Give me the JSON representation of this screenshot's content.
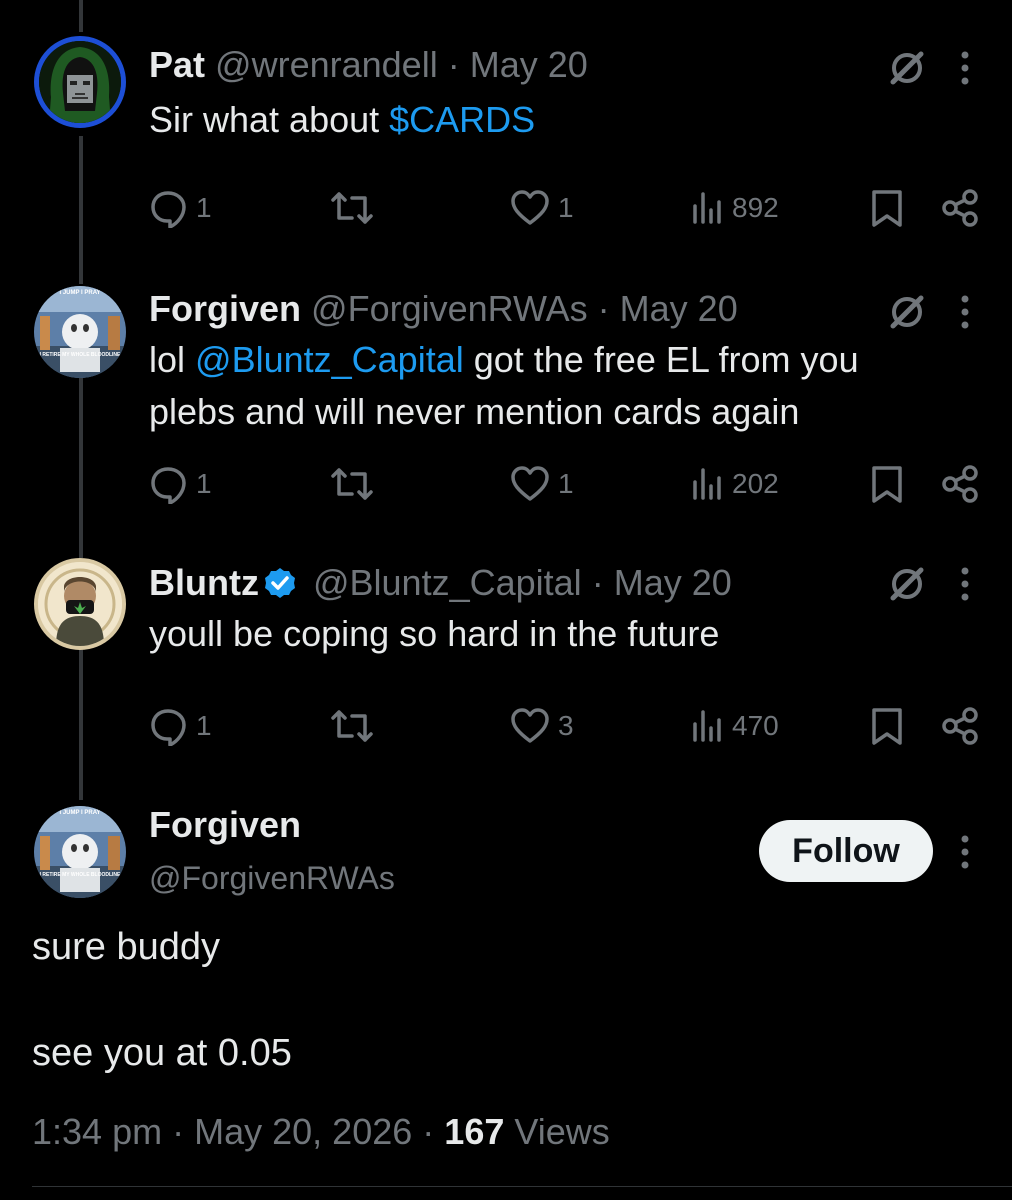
{
  "tweets": [
    {
      "name": "Pat",
      "handle": "@wrenrandell",
      "dot": "·",
      "date": "May 20",
      "text_plain": "Sir what about ",
      "text_link": "$CARDS",
      "replies": "1",
      "likes": "1",
      "views": "892"
    },
    {
      "name": "Forgiven",
      "handle": "@ForgivenRWAs",
      "dot": "·",
      "date": "May 20",
      "text_a": "lol ",
      "text_link": "@Bluntz_Capital",
      "text_b": " got the free EL from you plebs and will never mention cards again",
      "replies": "1",
      "likes": "1",
      "views": "202"
    },
    {
      "name": "Bluntz",
      "handle": "@Bluntz_Capital",
      "dot": "·",
      "date": "May 20",
      "text": "youll be coping so hard in the future",
      "replies": "1",
      "likes": "3",
      "views": "470"
    }
  ],
  "main": {
    "name": "Forgiven",
    "handle": "@ForgivenRWAs",
    "follow_label": "Follow",
    "line1": "sure buddy",
    "line2": "see you at 0.05",
    "time": "1:34 pm",
    "dot": "·",
    "date": "May 20, 2026",
    "dot2": "·",
    "views_count": "167",
    "views_label": " Views"
  },
  "avatar_text": {
    "top": "I JUMP I PRAY",
    "bottom": "I RETIRE MY WHOLE BLOODLINE"
  },
  "icons": [
    "reply-icon",
    "retweet-icon",
    "like-icon",
    "views-icon",
    "bookmark-icon",
    "share-icon",
    "grok-icon",
    "more-icon",
    "verified-badge-icon"
  ],
  "colors": {
    "background": "#000000",
    "text": "#e7e9ea",
    "muted": "#71767b",
    "link": "#1d9bf0",
    "verified": "#1d9bf0"
  }
}
